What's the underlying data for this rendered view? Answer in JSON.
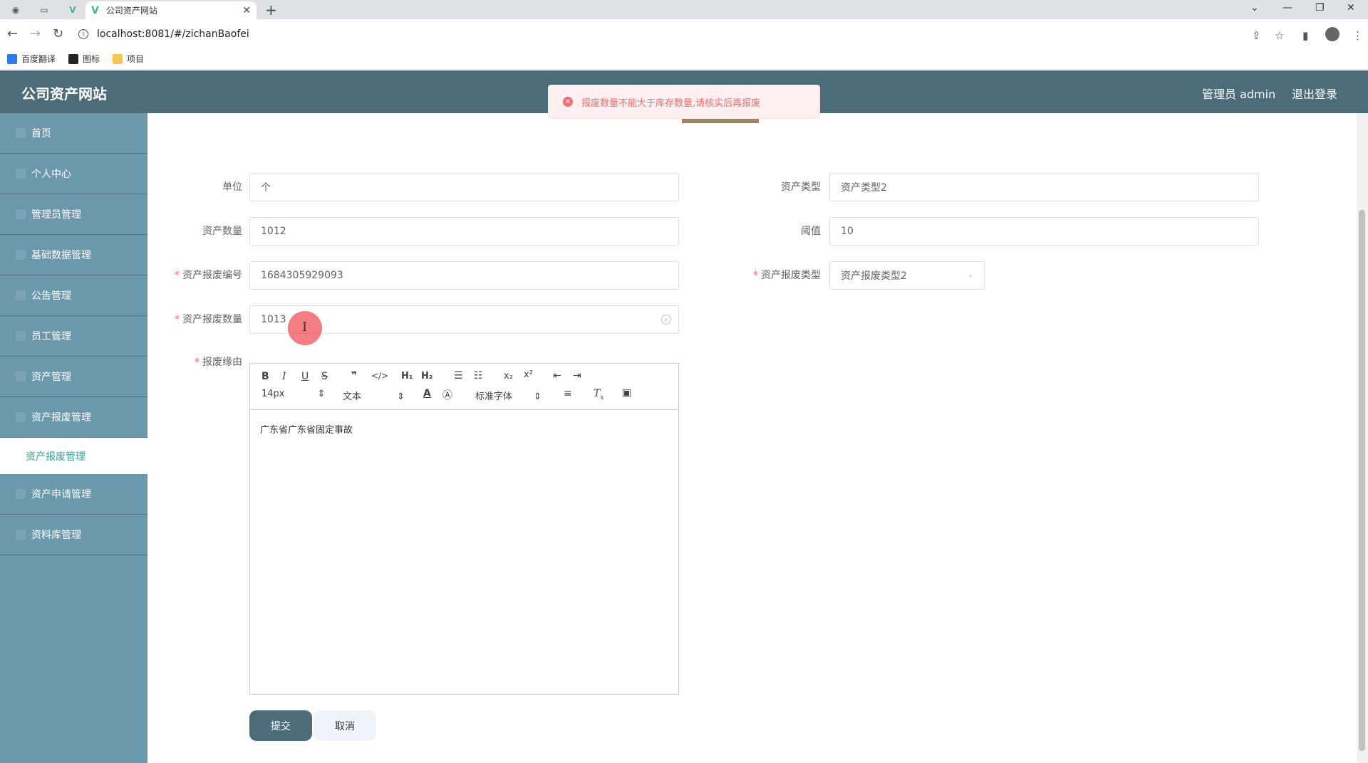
{
  "browser": {
    "tab_title": "公司资产网站",
    "url": "localhost:8081/#/zichanBaofei",
    "bookmarks": [
      "百度翻译",
      "图标",
      "项目"
    ]
  },
  "header": {
    "app_title": "公司资产网站",
    "user_label": "管理员 admin",
    "logout_label": "退出登录"
  },
  "sidebar": {
    "items": [
      {
        "label": "首页"
      },
      {
        "label": "个人中心"
      },
      {
        "label": "管理员管理"
      },
      {
        "label": "基础数据管理"
      },
      {
        "label": "公告管理"
      },
      {
        "label": "员工管理"
      },
      {
        "label": "资产管理"
      },
      {
        "label": "资产报废管理"
      },
      {
        "label": "资产申请管理"
      },
      {
        "label": "资料库管理"
      }
    ],
    "active_sub": "资产报废管理"
  },
  "toast": {
    "message": "报废数量不能大于库存数量,请核实后再报废",
    "color": "#f56c6c"
  },
  "form": {
    "unit_label": "单位",
    "unit_value": "个",
    "asset_type_label": "资产类型",
    "asset_type_value": "资产类型2",
    "quantity_label": "资产数量",
    "quantity_value": "1012",
    "threshold_label": "阈值",
    "threshold_value": "10",
    "scrap_code_label": "资产报废编号",
    "scrap_code_value": "1684305929093",
    "scrap_type_label": "资产报废类型",
    "scrap_type_value": "资产报废类型2",
    "scrap_qty_label": "资产报废数量",
    "scrap_qty_value": "1013",
    "reason_label": "报废缘由",
    "required_mark": "*"
  },
  "editor": {
    "font_size": "14px",
    "format": "文本",
    "font_family": "标准字体",
    "content": "广东省广东省固定事故"
  },
  "buttons": {
    "submit": "提交",
    "cancel": "取消"
  },
  "colors": {
    "header_bg": "#4d6c7a",
    "sidebar_bg": "#6b98ab",
    "active_text": "#2eaa92"
  }
}
